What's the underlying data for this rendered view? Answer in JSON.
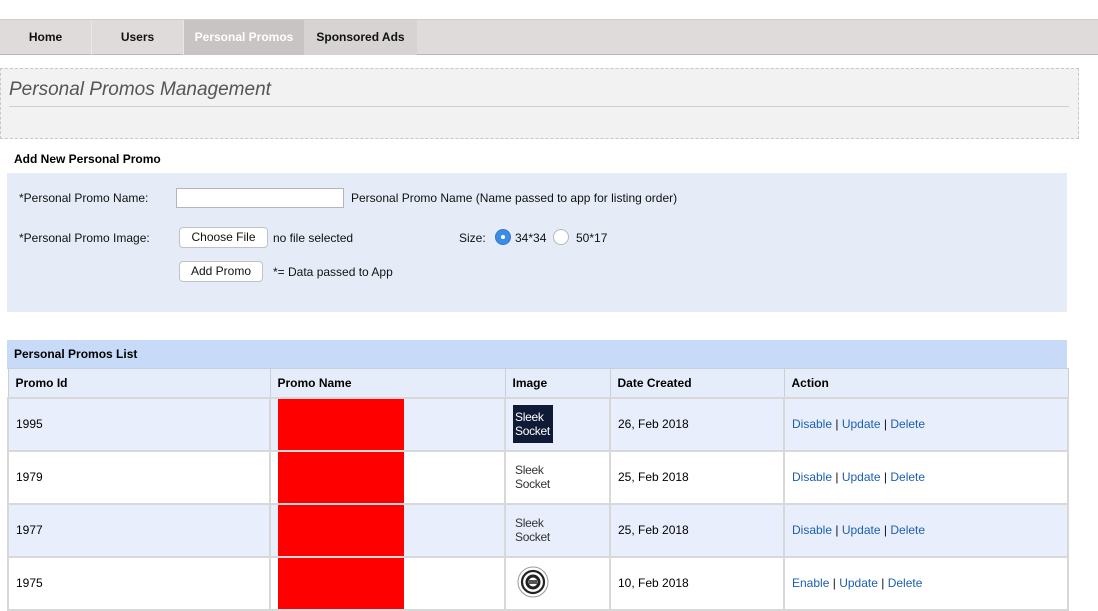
{
  "nav": {
    "tabs": [
      {
        "label": "Home"
      },
      {
        "label": "Users"
      },
      {
        "label": "Personal Promos"
      },
      {
        "label": "Sponsored Ads"
      }
    ],
    "active_tab": "Personal Promos"
  },
  "page": {
    "title": "Personal Promos Management"
  },
  "form": {
    "section_title": "Add New Personal Promo",
    "name_label": "*Personal Promo Name:",
    "name_value": "",
    "name_hint": "Personal Promo Name (Name passed to app for listing order)",
    "image_label": "*Personal Promo Image:",
    "choose_file_label": "Choose File",
    "file_status": "no file selected",
    "size_label": "Size:",
    "size_options": [
      {
        "label": "34*34",
        "checked": true
      },
      {
        "label": "50*17",
        "checked": false
      }
    ],
    "add_button_label": "Add Promo",
    "note": "*= Data passed to App"
  },
  "list": {
    "title": "Personal Promos List",
    "columns": [
      "Promo Id",
      "Promo Name",
      "Image",
      "Date Created",
      "Action"
    ],
    "rows": [
      {
        "id": "1995",
        "image_text": [
          "Sleek",
          "Socket"
        ],
        "image_style": "dark",
        "date": "26, Feb 2018",
        "actions": [
          "Disable",
          "Update",
          "Delete"
        ]
      },
      {
        "id": "1979",
        "image_text": [
          "Sleek",
          "Socket"
        ],
        "image_style": "light",
        "date": "25, Feb 2018",
        "actions": [
          "Disable",
          "Update",
          "Delete"
        ]
      },
      {
        "id": "1977",
        "image_text": [
          "Sleek",
          "Socket"
        ],
        "image_style": "light",
        "date": "25, Feb 2018",
        "actions": [
          "Disable",
          "Update",
          "Delete"
        ]
      },
      {
        "id": "1975",
        "image_text": [],
        "image_style": "seal",
        "date": "10, Feb 2018",
        "actions": [
          "Enable",
          "Update",
          "Delete"
        ]
      }
    ],
    "action_separator": "|"
  },
  "colors": {
    "nav_bg": "#dedbda",
    "active_tab_bg": "#c7c4c3",
    "form_bg": "#e5ecf8",
    "list_header_bg": "#c7daf7",
    "link": "#1a5fb4",
    "redaction": "#ff0000"
  },
  "icons": [
    "sleek-socket-logo",
    "seal-logo"
  ]
}
